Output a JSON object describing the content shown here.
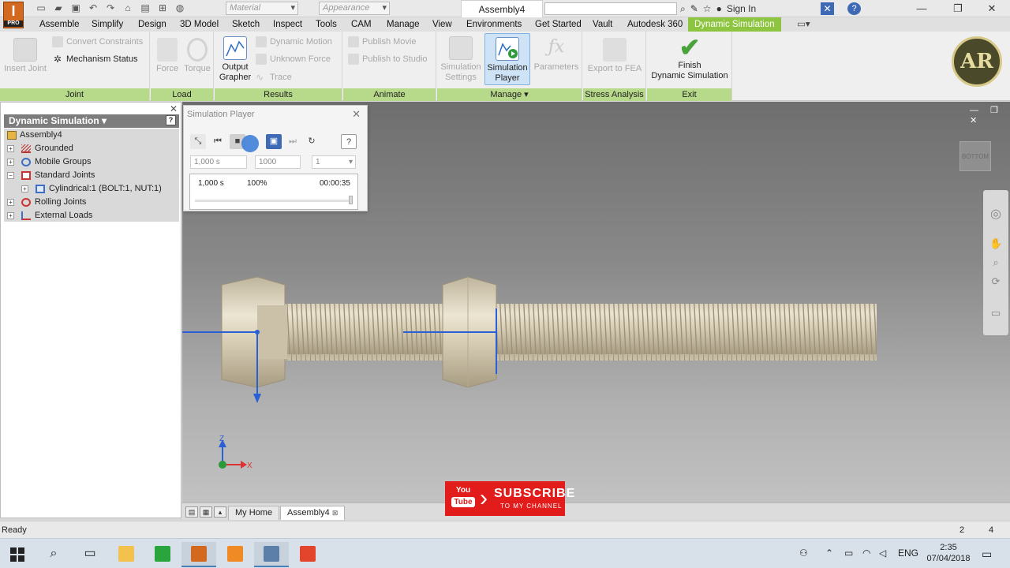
{
  "titlebar": {
    "app_logo": "I",
    "app_edition": "PRO",
    "material_placeholder": "Material",
    "appearance_placeholder": "Appearance",
    "document_title": "Assembly4",
    "sign_in": "Sign In"
  },
  "menu": {
    "tabs": [
      "Assemble",
      "Simplify",
      "Design",
      "3D Model",
      "Sketch",
      "Inspect",
      "Tools",
      "CAM",
      "Manage",
      "View",
      "Environments",
      "Get Started",
      "Vault",
      "Autodesk 360"
    ],
    "active_tab": "Dynamic Simulation"
  },
  "ribbon": {
    "joint": {
      "label": "Joint",
      "insert_joint": "Insert Joint",
      "convert_constraints": "Convert Constraints",
      "mechanism_status": "Mechanism Status"
    },
    "load": {
      "label": "Load",
      "force": "Force",
      "torque": "Torque"
    },
    "results": {
      "label": "Results",
      "output_grapher_l1": "Output",
      "output_grapher_l2": "Grapher",
      "dynamic_motion": "Dynamic Motion",
      "unknown_force": "Unknown Force",
      "trace": "Trace"
    },
    "animate": {
      "label": "Animate",
      "publish_movie": "Publish Movie",
      "publish_to_studio": "Publish to Studio"
    },
    "manage": {
      "label": "Manage",
      "simulation_settings_l1": "Simulation",
      "simulation_settings_l2": "Settings",
      "simulation_player_l1": "Simulation",
      "simulation_player_l2": "Player",
      "parameters": "Parameters"
    },
    "stress": {
      "label": "Stress Analysis",
      "export_to_fea": "Export to FEA"
    },
    "exit": {
      "label": "Exit",
      "finish_l1": "Finish",
      "finish_l2": "Dynamic Simulation"
    },
    "brand_logo": "AR"
  },
  "browser": {
    "title": "Dynamic Simulation",
    "tree": [
      {
        "label": "Assembly4"
      },
      {
        "label": "Grounded"
      },
      {
        "label": "Mobile Groups"
      },
      {
        "label": "Standard Joints"
      },
      {
        "label": "Cylindrical:1 (BOLT:1, NUT:1)"
      },
      {
        "label": "Rolling Joints"
      },
      {
        "label": "External Loads"
      }
    ]
  },
  "sim_player": {
    "title": "Simulation Player",
    "final_time": "1,000 s",
    "images": "1000",
    "filter": "1",
    "current_time": "1,000 s",
    "percent": "100%",
    "elapsed": "00:00:35",
    "progress_fraction": 1.0
  },
  "viewport": {
    "viewcube_label": "BOTTOM",
    "axis_z": "Z",
    "axis_x": "X"
  },
  "doc_tabs": [
    "My Home",
    "Assembly4"
  ],
  "subscribe": {
    "yt_line1": "You",
    "yt_line2": "Tube",
    "title": "SUBSCRIBE",
    "subtitle": "TO MY CHANNEL"
  },
  "status": {
    "text": "Ready",
    "count1": "2",
    "count2": "4"
  },
  "taskbar": {
    "language": "ENG",
    "time": "2:35",
    "date": "07/04/2018"
  },
  "colors": {
    "accent_green": "#8dc440",
    "panel_green": "#b7d98a",
    "axis_blue": "#2a5fd6"
  }
}
